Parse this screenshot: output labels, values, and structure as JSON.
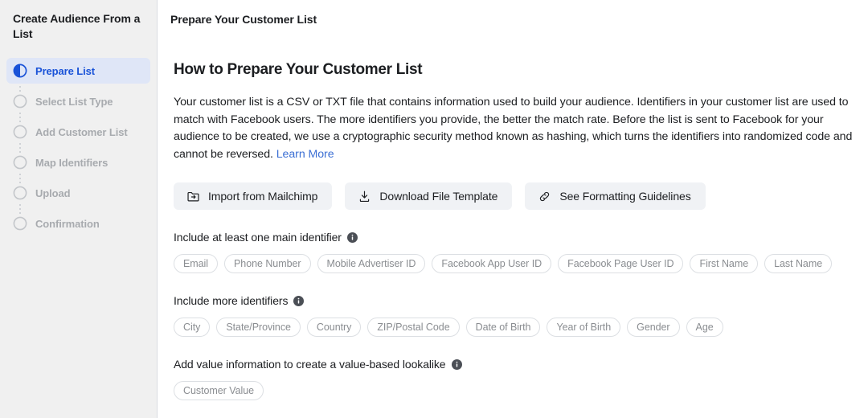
{
  "sidebar": {
    "title": "Create Audience From a List",
    "steps": [
      {
        "label": "Prepare List",
        "state": "active",
        "icon": "half-filled-circle-icon"
      },
      {
        "label": "Select List Type",
        "state": "inactive",
        "icon": "empty-circle-icon"
      },
      {
        "label": "Add Customer List",
        "state": "inactive",
        "icon": "empty-circle-icon"
      },
      {
        "label": "Map Identifiers",
        "state": "inactive",
        "icon": "empty-circle-icon"
      },
      {
        "label": "Upload",
        "state": "inactive",
        "icon": "empty-circle-icon"
      },
      {
        "label": "Confirmation",
        "state": "inactive",
        "icon": "empty-circle-icon"
      }
    ]
  },
  "header": {
    "title": "Prepare Your Customer List"
  },
  "main": {
    "section_title": "How to Prepare Your Customer List",
    "intro_text": "Your customer list is a CSV or TXT file that contains information used to build your audience. Identifiers in your customer list are used to match with Facebook users. The more identifiers you provide, the better the match rate. Before the list is sent to Facebook for your audience to be created, we use a cryptographic security method known as hashing, which turns the identifiers into randomized code and cannot be reversed. ",
    "learn_more_label": "Learn More",
    "actions": [
      {
        "label": "Import from Mailchimp",
        "icon": "folder-import-icon"
      },
      {
        "label": "Download File Template",
        "icon": "download-icon"
      },
      {
        "label": "See Formatting Guidelines",
        "icon": "link-chain-icon"
      }
    ],
    "groups": [
      {
        "label": "Include at least one main identifier",
        "info_icon": "info-circle-icon",
        "tags": [
          "Email",
          "Phone Number",
          "Mobile Advertiser ID",
          "Facebook App User ID",
          "Facebook Page User ID",
          "First Name",
          "Last Name"
        ]
      },
      {
        "label": "Include more identifiers",
        "info_icon": "info-circle-icon",
        "tags": [
          "City",
          "State/Province",
          "Country",
          "ZIP/Postal Code",
          "Date of Birth",
          "Year of Birth",
          "Gender",
          "Age"
        ]
      },
      {
        "label": "Add value information to create a value-based lookalike",
        "info_icon": "info-circle-icon",
        "tags": [
          "Customer Value"
        ]
      }
    ]
  },
  "colors": {
    "accent_blue": "#1a53d8",
    "link_blue": "#3b6fd4",
    "active_pill_bg": "#dfe6f7",
    "sidebar_bg": "#f0f0f0",
    "button_bg": "#f0f2f5",
    "muted_text": "#8a8d91"
  }
}
